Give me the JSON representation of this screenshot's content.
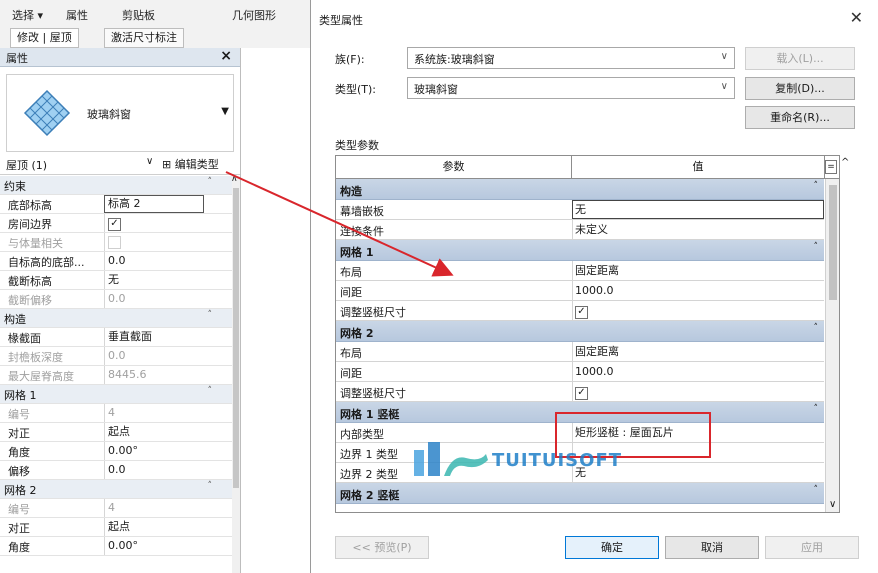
{
  "ribbon": {
    "select_label": "选择 ▾",
    "properties_label": "属性",
    "clipboard_label": "剪贴板",
    "geometry_label": "几何图形",
    "modify_tab": "修改 | 屋顶",
    "activate_dims_tab": "激活尺寸标注"
  },
  "palette": {
    "title": "属性",
    "type_name": "玻璃斜窗",
    "instance_filter": "屋顶 (1)",
    "edit_type": "编辑类型",
    "rows": [
      {
        "name": "约束",
        "value": "",
        "kind": "section"
      },
      {
        "name": "底部标高",
        "value": "标高 2",
        "kind": "row"
      },
      {
        "name": "房间边界",
        "value": "",
        "kind": "check"
      },
      {
        "name": "与体量相关",
        "value": "",
        "kind": "check-dis"
      },
      {
        "name": "自标高的底部...",
        "value": "0.0",
        "kind": "row"
      },
      {
        "name": "截断标高",
        "value": "无",
        "kind": "row"
      },
      {
        "name": "截断偏移",
        "value": "0.0",
        "kind": "dis"
      },
      {
        "name": "构造",
        "value": "",
        "kind": "section"
      },
      {
        "name": "椽截面",
        "value": "垂直截面",
        "kind": "row"
      },
      {
        "name": "封檐板深度",
        "value": "0.0",
        "kind": "dis"
      },
      {
        "name": "最大屋脊高度",
        "value": "8445.6",
        "kind": "dis"
      },
      {
        "name": "网格 1",
        "value": "",
        "kind": "section"
      },
      {
        "name": "编号",
        "value": "4",
        "kind": "dis"
      },
      {
        "name": "对正",
        "value": "起点",
        "kind": "row"
      },
      {
        "name": "角度",
        "value": "0.00°",
        "kind": "row"
      },
      {
        "name": "偏移",
        "value": "0.0",
        "kind": "row"
      },
      {
        "name": "网格 2",
        "value": "",
        "kind": "section"
      },
      {
        "name": "编号",
        "value": "4",
        "kind": "dis"
      },
      {
        "name": "对正",
        "value": "起点",
        "kind": "row"
      },
      {
        "name": "角度",
        "value": "0.00°",
        "kind": "row"
      }
    ]
  },
  "dialog": {
    "title": "类型属性",
    "family_label": "族(F):",
    "family_value": "系统族:玻璃斜窗",
    "type_label": "类型(T):",
    "type_value": "玻璃斜窗",
    "load_btn": "载入(L)...",
    "duplicate_btn": "复制(D)...",
    "rename_btn": "重命名(R)...",
    "type_params_label": "类型参数",
    "col_param": "参数",
    "col_value": "值",
    "rows": [
      {
        "name": "构造",
        "value": "",
        "kind": "section"
      },
      {
        "name": "幕墙嵌板",
        "value": "无",
        "kind": "boxed"
      },
      {
        "name": "连接条件",
        "value": "未定义",
        "kind": "row"
      },
      {
        "name": "网格 1",
        "value": "",
        "kind": "section"
      },
      {
        "name": "布局",
        "value": "固定距离",
        "kind": "row"
      },
      {
        "name": "间距",
        "value": "1000.0",
        "kind": "row"
      },
      {
        "name": "调整竖梃尺寸",
        "value": "",
        "kind": "check"
      },
      {
        "name": "网格 2",
        "value": "",
        "kind": "section"
      },
      {
        "name": "布局",
        "value": "固定距离",
        "kind": "row"
      },
      {
        "name": "间距",
        "value": "1000.0",
        "kind": "row"
      },
      {
        "name": "调整竖梃尺寸",
        "value": "",
        "kind": "check"
      },
      {
        "name": "网格 1 竖梃",
        "value": "",
        "kind": "section"
      },
      {
        "name": "内部类型",
        "value": "矩形竖梃 : 屋面瓦片",
        "kind": "row"
      },
      {
        "name": "边界 1 类型",
        "value": "",
        "kind": "row"
      },
      {
        "name": "边界 2 类型",
        "value": "无",
        "kind": "row"
      },
      {
        "name": "网格 2 竖梃",
        "value": "",
        "kind": "section"
      }
    ],
    "preview_btn": "<< 预览(P)",
    "ok_btn": "确定",
    "cancel_btn": "取消",
    "apply_btn": "应用"
  },
  "watermark": {
    "text": "TUITUISOFT"
  },
  "colors": {
    "highlight_box": "#d9262c",
    "arrow": "#d9262c",
    "section_bg": "#bccbe0",
    "primary_border": "#0078d7"
  }
}
